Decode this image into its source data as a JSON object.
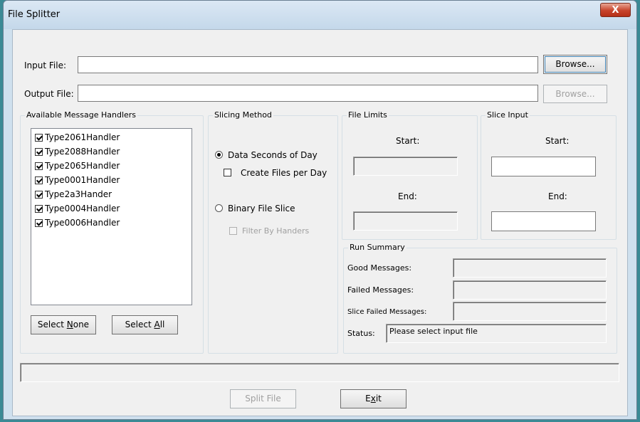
{
  "window": {
    "title": "File Splitter",
    "close_label": "X"
  },
  "input_file": {
    "label": "Input File:",
    "value": "",
    "browse_label": "Browse..."
  },
  "output_file": {
    "label": "Output File:",
    "value": "",
    "browse_label": "Browse..."
  },
  "handlers": {
    "title": "Available Message Handlers",
    "items": [
      {
        "label": "Type2061Handler",
        "checked": true
      },
      {
        "label": "Type2088Handler",
        "checked": true
      },
      {
        "label": "Type2065Handler",
        "checked": true
      },
      {
        "label": "Type0001Handler",
        "checked": true
      },
      {
        "label": "Type2a3Hander",
        "checked": true
      },
      {
        "label": "Type0004Handler",
        "checked": true
      },
      {
        "label": "Type0006Handler",
        "checked": true
      }
    ],
    "select_none_pre": "Select ",
    "select_none_key": "N",
    "select_none_post": "one",
    "select_all_pre": "Select ",
    "select_all_key": "A",
    "select_all_post": "ll"
  },
  "slicing": {
    "title": "Slicing Method",
    "option_seconds": "Data Seconds of Day",
    "create_files_per_day": "Create Files per Day",
    "option_binary": "Binary File Slice",
    "filter_by_handers": "Filter By Handers"
  },
  "file_limits": {
    "title": "File Limits",
    "start_label": "Start:",
    "end_label": "End:",
    "start_value": "",
    "end_value": ""
  },
  "slice_input": {
    "title": "Slice Input",
    "start_label": "Start:",
    "end_label": "End:",
    "start_value": "",
    "end_value": ""
  },
  "run_summary": {
    "title": "Run Summary",
    "good_label": "Good Messages:",
    "failed_label": "Failed Messages:",
    "slice_failed_label": "Slice Failed Messages:",
    "status_label": "Status:",
    "good_value": "",
    "failed_value": "",
    "slice_failed_value": "",
    "status_value": "Please select input file"
  },
  "footer": {
    "split_label": "Split File",
    "exit_pre": "E",
    "exit_key": "x",
    "exit_post": "it"
  }
}
